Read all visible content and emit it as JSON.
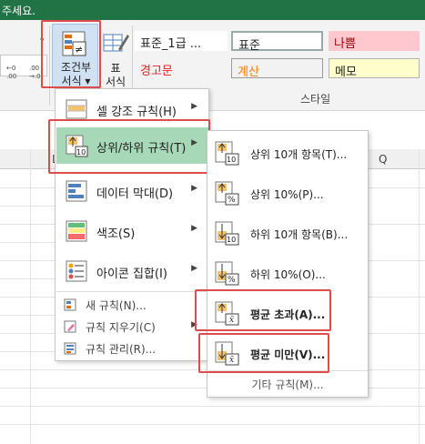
{
  "titlebar": {
    "text": "주세요."
  },
  "ribbon": {
    "format_buttons": [
      ".00 →.0",
      ".00 →.00"
    ],
    "conditional_format": {
      "line1": "조건부",
      "line2": "서식 ▾"
    },
    "format_as_table": {
      "line1": "표",
      "line2": "서식"
    },
    "styles": [
      {
        "label": "표준_1급 ...",
        "bg": "#ffffff",
        "color": "#222222"
      },
      {
        "label": "표준",
        "bg": "#ffffff",
        "color": "#222222"
      },
      {
        "label": "나쁨",
        "bg": "#ffc7ce",
        "color": "#9c0006"
      },
      {
        "label": "경고문",
        "bg": "#f3f3f3",
        "color": "#e02020"
      },
      {
        "label": "계산",
        "bg": "#f2f2f2",
        "color": "#fa7d00"
      },
      {
        "label": "메모",
        "bg": "#ffffcc",
        "color": "#222222"
      }
    ],
    "style_group": "스타일"
  },
  "columns": {
    "col_l": "L",
    "col_q": "Q"
  },
  "menu": {
    "items": [
      {
        "label": "셀 강조 규칙(H)",
        "icon": "highlight-cells-icon",
        "submenu": true
      },
      {
        "label": "상위/하위 규칙(T)",
        "icon": "top-bottom-icon",
        "submenu": true,
        "active": true
      },
      {
        "label": "데이터 막대(D)",
        "icon": "data-bars-icon",
        "submenu": true
      },
      {
        "label": "색조(S)",
        "icon": "color-scales-icon",
        "submenu": true
      },
      {
        "label": "아이콘 집합(I)",
        "icon": "icon-sets-icon",
        "submenu": true
      }
    ],
    "small_items": [
      {
        "label": "새 규칙(N)...",
        "icon": "new-rule-icon"
      },
      {
        "label": "규칙 지우기(C)",
        "icon": "clear-rules-icon",
        "submenu": true
      },
      {
        "label": "규칙 관리(R)...",
        "icon": "manage-rules-icon"
      }
    ]
  },
  "submenu": {
    "items": [
      {
        "label": "상위 10개 항목(T)...",
        "badge": "10",
        "dir": "up"
      },
      {
        "label": "상위 10%(P)...",
        "badge": "%",
        "dir": "up"
      },
      {
        "label": "하위 10개 항목(B)...",
        "badge": "10",
        "dir": "down"
      },
      {
        "label": "하위 10%(O)...",
        "badge": "%",
        "dir": "down"
      },
      {
        "label": "평균 초과(A)...",
        "badge": "x̄",
        "dir": "up"
      },
      {
        "label": "평균 미만(V)...",
        "badge": "x̄",
        "dir": "down"
      }
    ],
    "more": "기타 규칙(M)..."
  },
  "colors": {
    "accent": "#217346",
    "hover_green": "#a7d8b8",
    "highlight_red": "#e04b4b"
  }
}
